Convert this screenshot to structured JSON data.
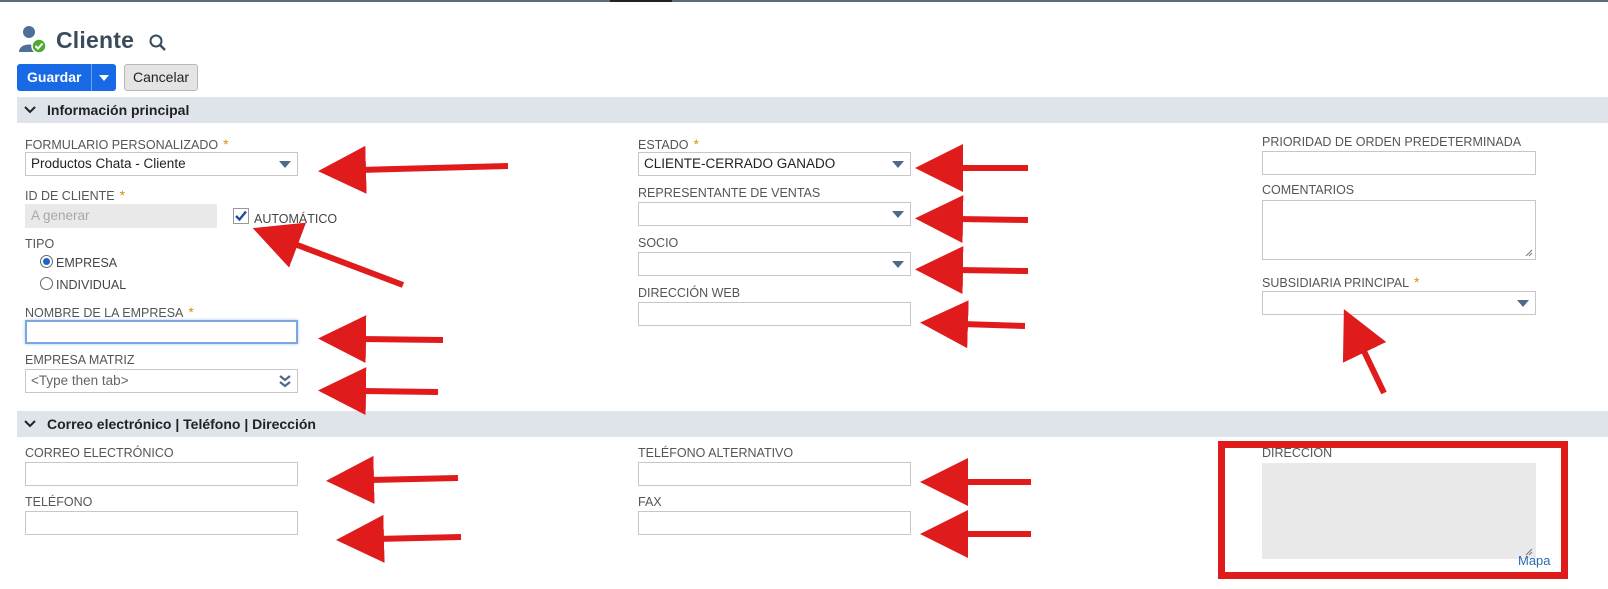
{
  "header": {
    "title": "Cliente",
    "icon": "customer-icon",
    "search_icon": "search-icon"
  },
  "toolbar": {
    "save_label": "Guardar",
    "cancel_label": "Cancelar"
  },
  "sections": {
    "main_info": {
      "title": "Información principal"
    },
    "contact": {
      "title": "Correo electrónico | Teléfono | Dirección"
    }
  },
  "fields": {
    "custom_form": {
      "label": "FORMULARIO PERSONALIZADO",
      "value": "Productos Chata - Cliente",
      "required": true
    },
    "customer_id": {
      "label": "ID DE CLIENTE",
      "placeholder": "A generar",
      "required": true,
      "auto_label": "AUTOMÁTICO",
      "auto_checked": true
    },
    "type": {
      "label": "TIPO",
      "options": [
        "EMPRESA",
        "INDIVIDUAL"
      ],
      "selected": "EMPRESA"
    },
    "company_name": {
      "label": "NOMBRE DE LA EMPRESA",
      "value": "",
      "required": true
    },
    "parent_company": {
      "label": "EMPRESA MATRIZ",
      "placeholder": "<Type then tab>"
    },
    "status": {
      "label": "ESTADO",
      "value": "CLIENTE-CERRADO GANADO",
      "required": true
    },
    "sales_rep": {
      "label": "REPRESENTANTE DE VENTAS",
      "value": ""
    },
    "partner": {
      "label": "SOCIO",
      "value": ""
    },
    "web_address": {
      "label": "DIRECCIÓN WEB",
      "value": ""
    },
    "default_order_priority": {
      "label": "PRIORIDAD DE ORDEN PREDETERMINADA",
      "value": ""
    },
    "comments": {
      "label": "COMENTARIOS",
      "value": ""
    },
    "primary_subsidiary": {
      "label": "SUBSIDIARIA PRINCIPAL",
      "value": "",
      "required": true
    },
    "email": {
      "label": "CORREO ELECTRÓNICO",
      "value": ""
    },
    "phone": {
      "label": "TELÉFONO",
      "value": ""
    },
    "alt_phone": {
      "label": "TELÉFONO ALTERNATIVO",
      "value": ""
    },
    "fax": {
      "label": "FAX",
      "value": ""
    },
    "address": {
      "label": "DIRECCIÓN",
      "value": "",
      "map_link": "Mapa"
    }
  },
  "colors": {
    "primary_button": "#1869e6",
    "section_bar": "#dfe4eb",
    "annotation_red": "#e01b1b",
    "required_star": "#d99000"
  }
}
